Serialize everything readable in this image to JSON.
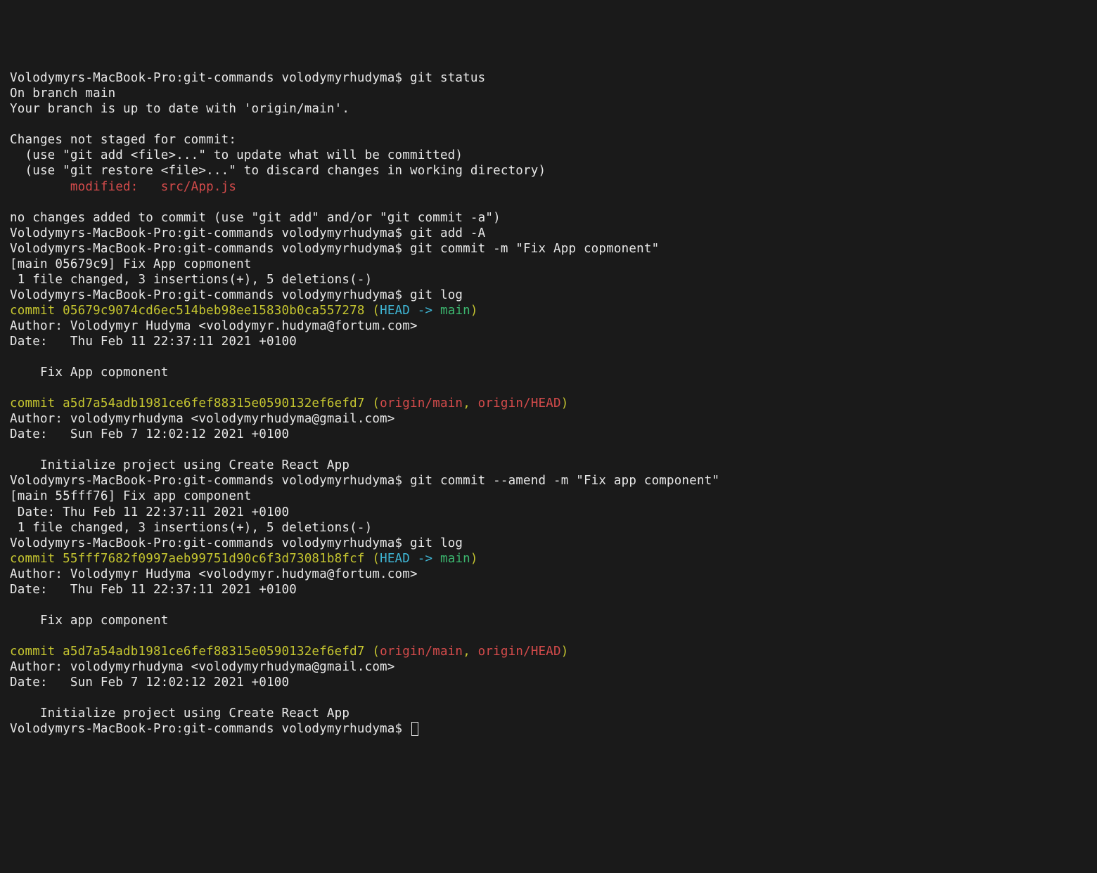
{
  "prompt": "Volodymyrs-MacBook-Pro:git-commands volodymyrhudyma$ ",
  "cmd": {
    "status": "git status",
    "addA": "git add -A",
    "commit1": "git commit -m \"Fix App copmonent\"",
    "log": "git log",
    "amend": "git commit --amend -m \"Fix app component\"",
    "log2": "git log"
  },
  "status": {
    "branch": "On branch main",
    "upToDate": "Your branch is up to date with 'origin/main'.",
    "notStaged": "Changes not staged for commit:",
    "hint1": "  (use \"git add <file>...\" to update what will be committed)",
    "hint2": "  (use \"git restore <file>...\" to discard changes in working directory)",
    "modified": "        modified:   src/App.js",
    "noChanges": "no changes added to commit (use \"git add\" and/or \"git commit -a\")"
  },
  "commitResult1": {
    "line1": "[main 05679c9] Fix App copmonent",
    "line2": " 1 file changed, 3 insertions(+), 5 deletions(-)"
  },
  "log1": {
    "c1sha": "commit 05679c9074cd6ec514beb98ee15830b0ca557278",
    "lp": " (",
    "head": "HEAD -> ",
    "main": "main",
    "rp": ")",
    "c1author": "Author: Volodymyr Hudyma <volodymyr.hudyma@fortum.com>",
    "c1date": "Date:   Thu Feb 11 22:37:11 2021 +0100",
    "c1msg": "    Fix App copmonent",
    "c2sha": "commit a5d7a54adb1981ce6fef88315e0590132ef6efd7",
    "refs2a": "origin/main",
    "comma": ", ",
    "refs2b": "origin/HEAD",
    "c2author": "Author: volodymyrhudyma <volodymyrhudyma@gmail.com>",
    "c2date": "Date:   Sun Feb 7 12:02:12 2021 +0100",
    "c2msg": "    Initialize project using Create React App"
  },
  "amendResult": {
    "line1": "[main 55fff76] Fix app component",
    "line2": " Date: Thu Feb 11 22:37:11 2021 +0100",
    "line3": " 1 file changed, 3 insertions(+), 5 deletions(-)"
  },
  "log2": {
    "c1sha": "commit 55fff7682f0997aeb99751d90c6f3d73081b8fcf",
    "c1author": "Author: Volodymyr Hudyma <volodymyr.hudyma@fortum.com>",
    "c1date": "Date:   Thu Feb 11 22:37:11 2021 +0100",
    "c1msg": "    Fix app component",
    "c2sha": "commit a5d7a54adb1981ce6fef88315e0590132ef6efd7",
    "c2author": "Author: volodymyrhudyma <volodymyrhudyma@gmail.com>",
    "c2date": "Date:   Sun Feb 7 12:02:12 2021 +0100",
    "c2msg": "    Initialize project using Create React App"
  }
}
